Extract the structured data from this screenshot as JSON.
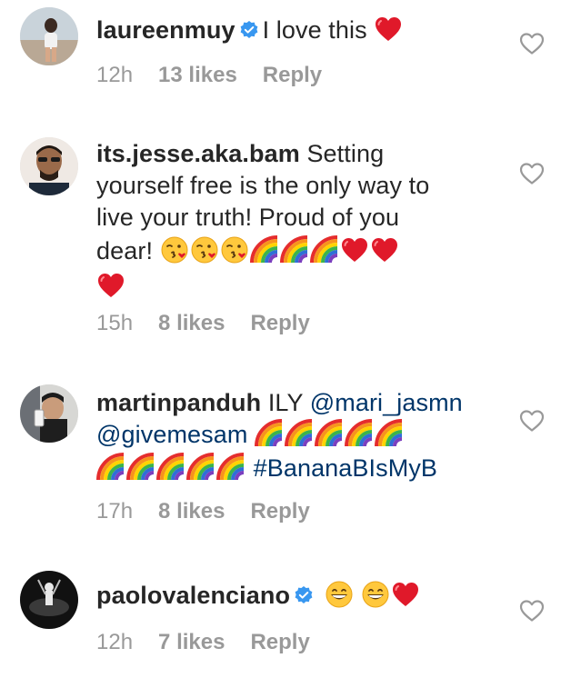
{
  "comments": [
    {
      "username": "laureenmuy",
      "verified": true,
      "segments": [
        {
          "type": "text",
          "value": "I love this "
        }
      ],
      "time": "12h",
      "likes": "13 likes",
      "reply": "Reply"
    },
    {
      "username": "its.jesse.aka.bam",
      "verified": false,
      "text_line1": "Setting",
      "text_line2": "yourself free is the only way to",
      "text_line3": "live your truth! Proud of you",
      "text_line4": "dear! ",
      "time": "15h",
      "likes": "8 likes",
      "reply": "Reply"
    },
    {
      "username": "martinpanduh",
      "text_ily": "ILY ",
      "mention1": "@mari_jasmn",
      "mention2": "@givemesam",
      "hashtag": "#BananaBIsMyB",
      "time": "17h",
      "likes": "8 likes",
      "reply": "Reply"
    },
    {
      "username": "paolovalenciano",
      "verified": true,
      "time": "12h",
      "likes": "7 likes",
      "reply": "Reply"
    }
  ],
  "icons": {
    "like": "heart-outline-icon",
    "verified": "verified-badge-icon",
    "emoji_heart": "red-heart-emoji",
    "emoji_kiss": "face-blowing-kiss-emoji",
    "emoji_rainbow": "rainbow-emoji",
    "emoji_grin": "grinning-face-emoji"
  },
  "colors": {
    "text": "#262626",
    "meta": "#999999",
    "link": "#003569",
    "verified": "#3897f0",
    "heart": "#e0192a"
  }
}
